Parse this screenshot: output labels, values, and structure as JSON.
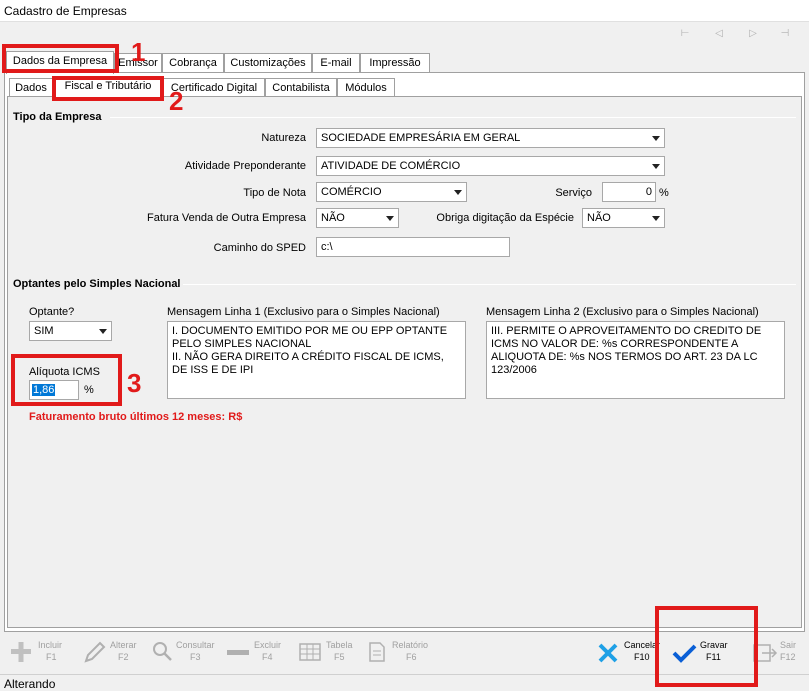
{
  "window": {
    "title": "Cadastro de Empresas"
  },
  "main_tabs": [
    "Dados da Empresa",
    "Emissor",
    "Cobrança",
    "Customizações",
    "E-mail",
    "Impressão"
  ],
  "sub_tabs": [
    "Dados",
    "Fiscal e Tributário",
    "Certificado Digital",
    "Contabilista",
    "Módulos"
  ],
  "tipo_empresa": {
    "title": "Tipo da Empresa",
    "natureza_label": "Natureza",
    "natureza_value": "SOCIEDADE EMPRESÁRIA EM GERAL",
    "atividade_label": "Atividade Preponderante",
    "atividade_value": "ATIVIDADE DE COMÉRCIO",
    "tipo_nota_label": "Tipo de Nota",
    "tipo_nota_value": "COMÉRCIO",
    "servico_label": "Serviço",
    "servico_value": "0",
    "servico_unit": "%",
    "fatura_label": "Fatura Venda de Outra Empresa",
    "fatura_value": "NÃO",
    "obriga_label": "Obriga digitação da Espécie",
    "obriga_value": "NÃO",
    "caminho_label": "Caminho do SPED",
    "caminho_value": "c:\\"
  },
  "simples": {
    "title": "Optantes pelo Simples Nacional",
    "optante_label": "Optante?",
    "optante_value": "SIM",
    "msg1_label": "Mensagem Linha 1 (Exclusivo para  o Simples Nacional)",
    "msg1_text": "I. DOCUMENTO EMITIDO POR ME OU EPP OPTANTE PELO SIMPLES NACIONAL\nII. NÃO GERA DIREITO A CRÉDITO FISCAL DE ICMS, DE ISS E DE IPI",
    "msg2_label": "Mensagem Linha 2 (Exclusivo para o Simples Nacional)",
    "msg2_text": "III. PERMITE O APROVEITAMENTO DO CREDITO DE ICMS NO VALOR DE: %s CORRESPONDENTE A ALIQUOTA DE: %s NOS TERMOS DO ART. 23 DA LC 123/2006",
    "aliquota_label": "Alíquota ICMS",
    "aliquota_value": "1,86",
    "aliquota_unit": "%",
    "faturamento": "Faturamento bruto últimos 12 meses: R$"
  },
  "annotations": [
    "1",
    "2",
    "3"
  ],
  "toolbar": [
    {
      "label": "Incluir",
      "key": "F1"
    },
    {
      "label": "Alterar",
      "key": "F2"
    },
    {
      "label": "Consultar",
      "key": "F3"
    },
    {
      "label": "Excluir",
      "key": "F4"
    },
    {
      "label": "Tabela",
      "key": "F5"
    },
    {
      "label": "Relatório",
      "key": "F6"
    },
    {
      "label": "Cancelar",
      "key": "F10"
    },
    {
      "label": "Gravar",
      "key": "F11"
    },
    {
      "label": "Sair",
      "key": "F12"
    }
  ],
  "status": {
    "text": "Alterando"
  },
  "colors": {
    "annotation": "#e11a1a",
    "accept": "#0a5fd6",
    "cancel": "#1ea0e6"
  }
}
